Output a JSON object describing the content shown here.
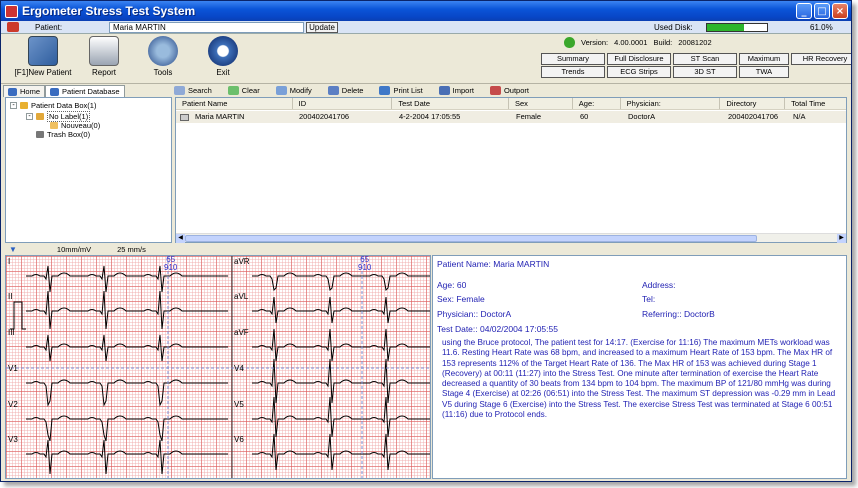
{
  "window": {
    "title": "Ergometer Stress Test System"
  },
  "patient_bar": {
    "label": "Patient:",
    "value": "Maria  MARTIN",
    "update_label": "Update",
    "disk_label": "Used Disk:",
    "disk_fraction": 0.61,
    "disk_text": "61.0%"
  },
  "toolbar": {
    "new_patient": "[F1]New Patient",
    "report": "Report",
    "tools": "Tools",
    "exit": "Exit"
  },
  "version": {
    "label": "Version:",
    "value": "4.00.0001",
    "build_label": "Build:",
    "build": "20081202"
  },
  "views": [
    "Summary",
    "Full Disclosure",
    "ST Scan",
    "Maximum",
    "HR Recovery",
    "Trends",
    "ECG Strips",
    "3D ST",
    "TWA"
  ],
  "tabs": [
    "Home",
    "Patient Database"
  ],
  "actions": [
    "Search",
    "Clear",
    "Modify",
    "Delete",
    "Print List",
    "Import",
    "Outport"
  ],
  "tree": {
    "root": "Patient Data Box(1)",
    "label": "No Label(1)",
    "child": "Nouveau(0)",
    "trash": "Trash Box(0)"
  },
  "list": {
    "columns": [
      "Patient Name",
      "ID",
      "Test Date",
      "Sex",
      "Age:",
      "Physician:",
      "Directory",
      "Total Time"
    ],
    "rows": [
      [
        "Maria  MARTIN",
        "200402041706",
        "4-2-2004 17:05:55",
        "Female",
        "60",
        "DoctorA",
        "200402041706",
        "N/A"
      ]
    ]
  },
  "ecg_bar": {
    "gain": "10mm/mV",
    "speed": "25 mm/s"
  },
  "ecg": {
    "leads": [
      "I",
      "II",
      "III",
      "V1",
      "V2",
      "V3",
      "aVR",
      "aVL",
      "aVF",
      "V4",
      "V5",
      "V6"
    ],
    "hr_top": "65",
    "hr_bottom": "910"
  },
  "report": {
    "name": "Patient Name: Maria  MARTIN",
    "age": "Age: 60",
    "address": "Address:",
    "sex": "Sex: Female",
    "tel": "Tel:",
    "physician": "Physician:: DoctorA",
    "referring": "Referring:: DoctorB",
    "test_date": "Test Date:: 04/02/2004 17:05:55",
    "summary": "using the Bruce protocol,  The patient test for 14:17.  (Exercise for 11:16)  The maximum METs workload was 11.6.  Resting Heart Rate was 68 bpm, and increased to a maximum Heart Rate of 153 bpm.  The Max HR of 153 represents 112% of the Target Heart Rate of 136.  The Max HR of 153 was achieved during Stage 1 (Recovery) at 00:11 (11:27) into the Stress Test.  One minute after termination of exercise the Heart Rate decreased a quantity of 30 beats from 134 bpm to 104 bpm.  The maximum BP of 121/80 mmHg was during Stage 4 (Exercise) at 02:26 (06:51) into the Stress Test.  The maximum ST depression was -0.29 mm in Lead V5 during Stage 6 (Exercise) into the Stress Test.  The exercise Stress Test was terminated at Stage 6 00:51 (11:16) due to Protocol ends."
  }
}
